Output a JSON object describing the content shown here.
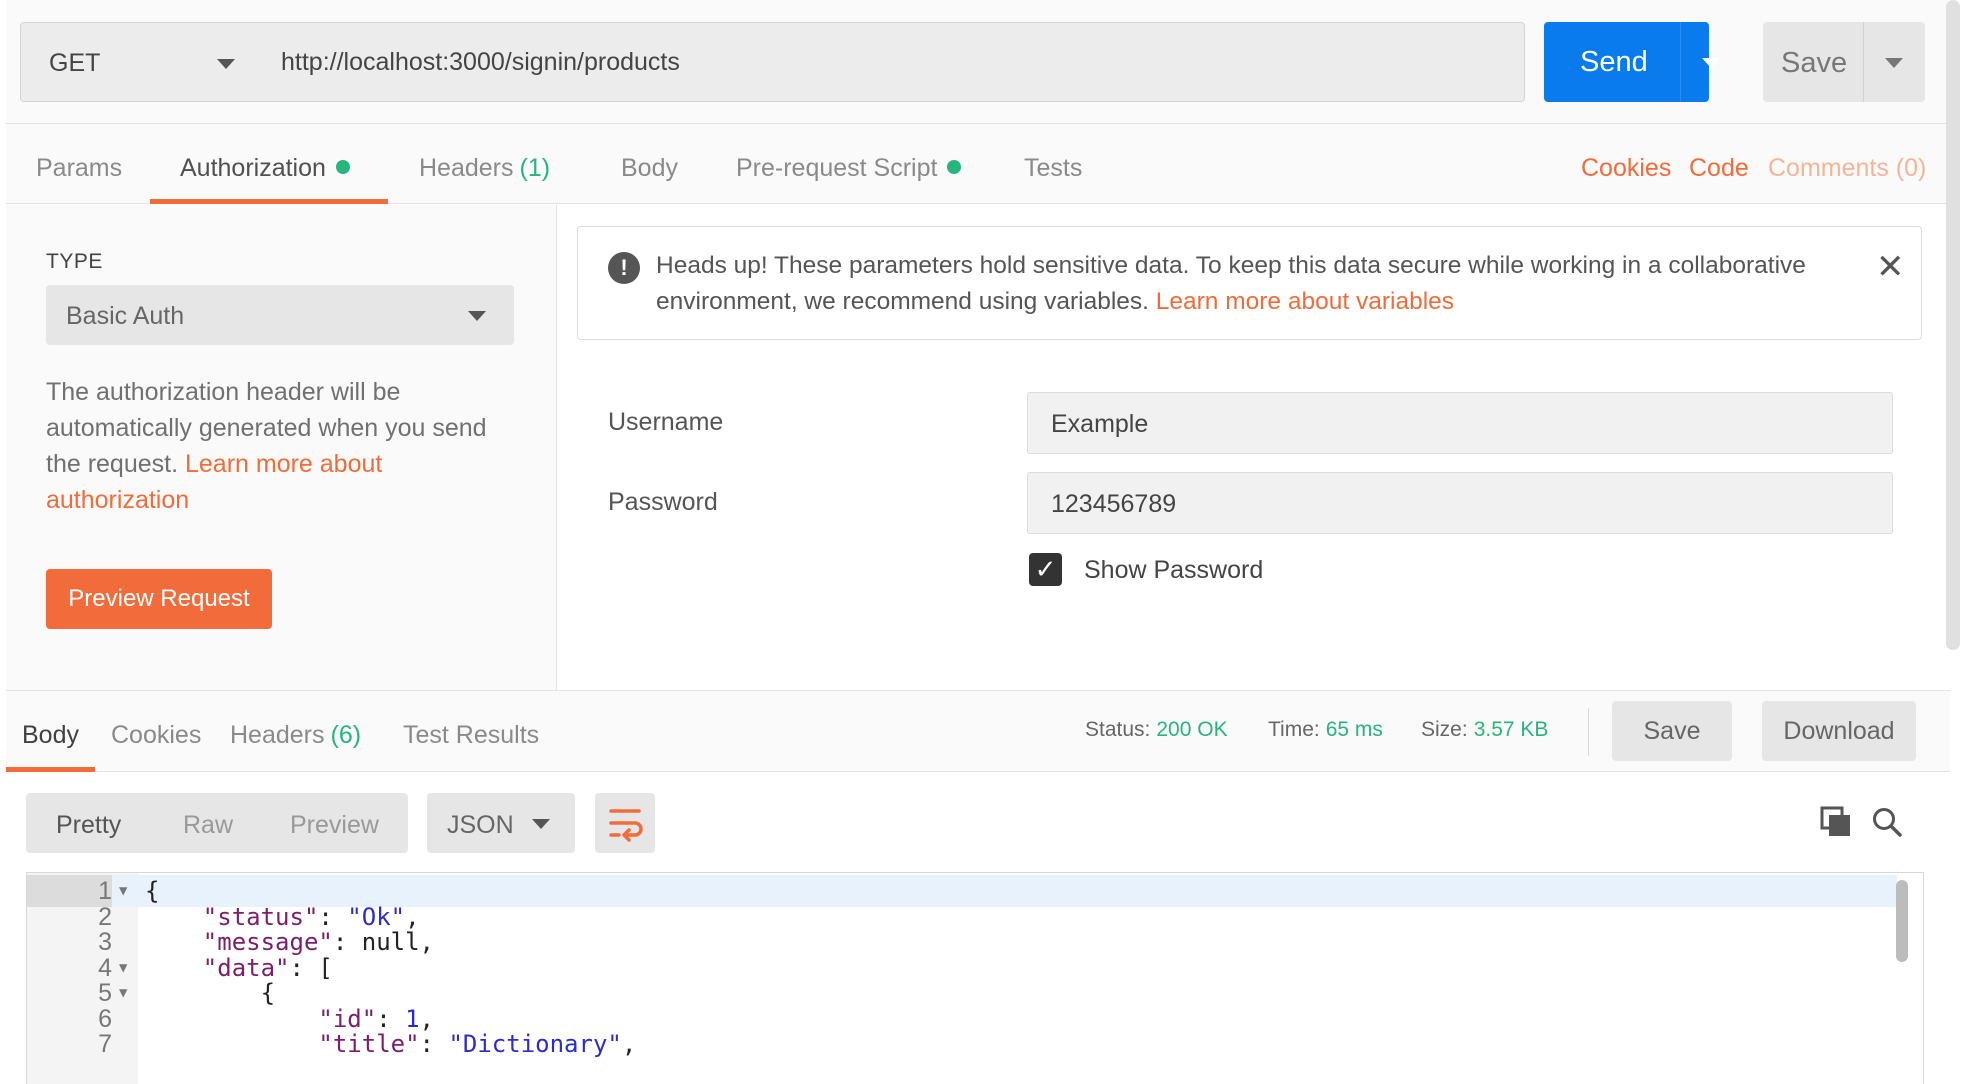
{
  "request": {
    "method": "GET",
    "url": "http://localhost:3000/signin/products",
    "send_label": "Send",
    "save_label": "Save"
  },
  "request_tabs": {
    "params": "Params",
    "authorization": "Authorization",
    "headers": "Headers",
    "headers_count": "(1)",
    "body": "Body",
    "prerequest": "Pre-request Script",
    "tests": "Tests"
  },
  "right_links": {
    "cookies": "Cookies",
    "code": "Code",
    "comments": "Comments (0)"
  },
  "auth": {
    "type_label": "TYPE",
    "type_value": "Basic Auth",
    "description": "The authorization header will be automatically generated when you send the request. ",
    "learn_more": "Learn more about authorization",
    "preview_button": "Preview Request",
    "alert_text": "Heads up! These parameters hold sensitive data. To keep this data secure while working in a collaborative environment, we recommend using variables. ",
    "alert_link": "Learn more about variables",
    "username_label": "Username",
    "username_value": "Example",
    "password_label": "Password",
    "password_value": "123456789",
    "show_password_label": "Show Password",
    "show_password_checked": true
  },
  "response_tabs": {
    "body": "Body",
    "cookies": "Cookies",
    "headers": "Headers",
    "headers_count": "(6)",
    "test_results": "Test Results"
  },
  "response_meta": {
    "status_label": "Status:",
    "status_value": "200 OK",
    "time_label": "Time:",
    "time_value": "65 ms",
    "size_label": "Size:",
    "size_value": "3.57 KB",
    "save_label": "Save",
    "download_label": "Download"
  },
  "format": {
    "pretty": "Pretty",
    "raw": "Raw",
    "preview": "Preview",
    "language": "JSON"
  },
  "code_lines": [
    {
      "n": "1",
      "text": "{"
    },
    {
      "n": "2",
      "key": "\"status\"",
      "value": "\"Ok\"",
      "tail": ","
    },
    {
      "n": "3",
      "key": "\"message\"",
      "value": "null",
      "tail": ","
    },
    {
      "n": "4",
      "key": "\"data\"",
      "value": "[",
      "tail": ""
    },
    {
      "n": "5",
      "text": "{"
    },
    {
      "n": "6",
      "key": "\"id\"",
      "value": "1",
      "tail": ","
    },
    {
      "n": "7",
      "key": "\"title\"",
      "value": "\"Dictionary\"",
      "tail": ","
    }
  ],
  "colors": {
    "accent": "#f26b3a",
    "send_blue": "#097bed",
    "success_green": "#26b47f"
  }
}
